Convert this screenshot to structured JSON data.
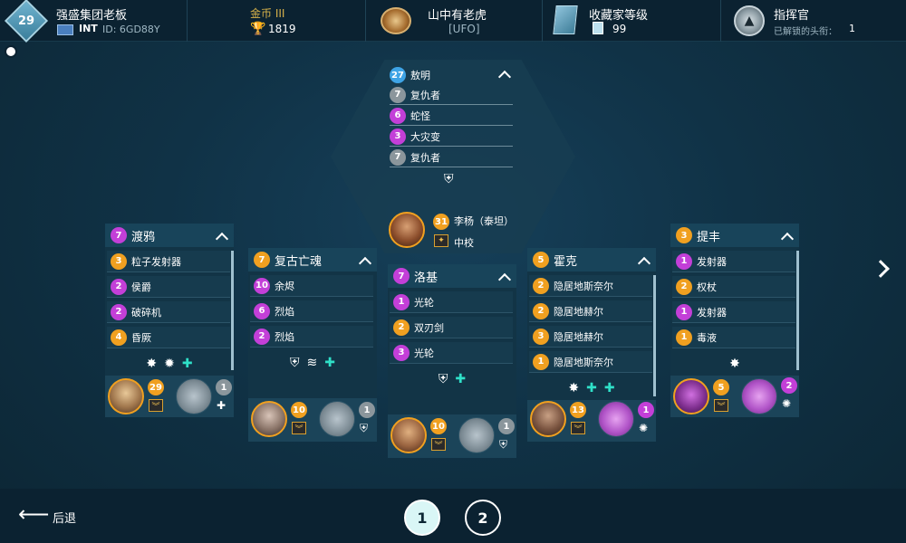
{
  "topbar": {
    "player_level": "29",
    "player_name": "强盛集团老板",
    "flag_region": "INT",
    "id_label": "ID: 6GD88Y",
    "currency_title": "金币 III",
    "trophies": "1819",
    "team_name": "山中有老虎",
    "team_tag": "[UFO]",
    "collector_title": "收藏家等级",
    "collector_value": "99",
    "commander_title": "指挥官",
    "commander_sub": "已解锁的头衔：",
    "commander_value": "1"
  },
  "leader": {
    "header_badge": "27",
    "header_name": "敖明",
    "rows": [
      {
        "badge": "7",
        "name": "复仇者",
        "color": "gray"
      },
      {
        "badge": "6",
        "name": "蛇怪",
        "color": "purple"
      },
      {
        "badge": "3",
        "name": "大灾变",
        "color": "purple"
      },
      {
        "badge": "7",
        "name": "复仇者",
        "color": "gray"
      }
    ],
    "commander_level": "31",
    "commander_name": "李杨（泰坦）",
    "commander_rank": "中校"
  },
  "cards": [
    {
      "level": "7",
      "name": "渡鸦",
      "head_color": "purple",
      "rows": [
        {
          "badge": "3",
          "name": "粒子发射器",
          "color": "orange"
        },
        {
          "badge": "2",
          "name": "侯爵",
          "color": "purple"
        },
        {
          "badge": "2",
          "name": "破碎机",
          "color": "purple"
        },
        {
          "badge": "4",
          "name": "昏厥",
          "color": "orange"
        }
      ],
      "pilot_level": "29",
      "ship_level": "1",
      "ship_level_color": "gray"
    },
    {
      "level": "7",
      "name": "复古亡魂",
      "head_color": "orange",
      "rows": [
        {
          "badge": "10",
          "name": "余烬",
          "color": "purple"
        },
        {
          "badge": "6",
          "name": "烈焰",
          "color": "purple"
        },
        {
          "badge": "2",
          "name": "烈焰",
          "color": "purple"
        }
      ],
      "pilot_level": "10",
      "ship_level": "1",
      "ship_level_color": "gray"
    },
    {
      "level": "7",
      "name": "洛基",
      "head_color": "purple",
      "rows": [
        {
          "badge": "1",
          "name": "光轮",
          "color": "purple"
        },
        {
          "badge": "2",
          "name": "双刃剑",
          "color": "orange"
        },
        {
          "badge": "3",
          "name": "光轮",
          "color": "purple"
        }
      ],
      "pilot_level": "10",
      "ship_level": "1",
      "ship_level_color": "gray"
    },
    {
      "level": "5",
      "name": "霍克",
      "head_color": "orange",
      "rows": [
        {
          "badge": "2",
          "name": "隐居地斯奈尔",
          "color": "orange"
        },
        {
          "badge": "2",
          "name": "隐居地赫尔",
          "color": "orange"
        },
        {
          "badge": "3",
          "name": "隐居地赫尔",
          "color": "orange"
        },
        {
          "badge": "1",
          "name": "隐居地斯奈尔",
          "color": "orange"
        }
      ],
      "pilot_level": "13",
      "ship_level": "1",
      "ship_level_color": "purple"
    },
    {
      "level": "3",
      "name": "提丰",
      "head_color": "orange",
      "rows": [
        {
          "badge": "1",
          "name": "发射器",
          "color": "purple"
        },
        {
          "badge": "2",
          "name": "权杖",
          "color": "orange"
        },
        {
          "badge": "1",
          "name": "发射器",
          "color": "purple"
        },
        {
          "badge": "1",
          "name": "毒液",
          "color": "orange"
        }
      ],
      "pilot_level": "5",
      "ship_level": "2",
      "ship_level_color": "purple"
    }
  ],
  "bottombar": {
    "back_label": "后退",
    "page1": "1",
    "page2": "2"
  },
  "colors": {
    "purple": "#c33fd8",
    "orange": "#f0a020",
    "gray": "#8b969c",
    "blue": "#3ea4e6",
    "teal": "#2fe0c8"
  }
}
